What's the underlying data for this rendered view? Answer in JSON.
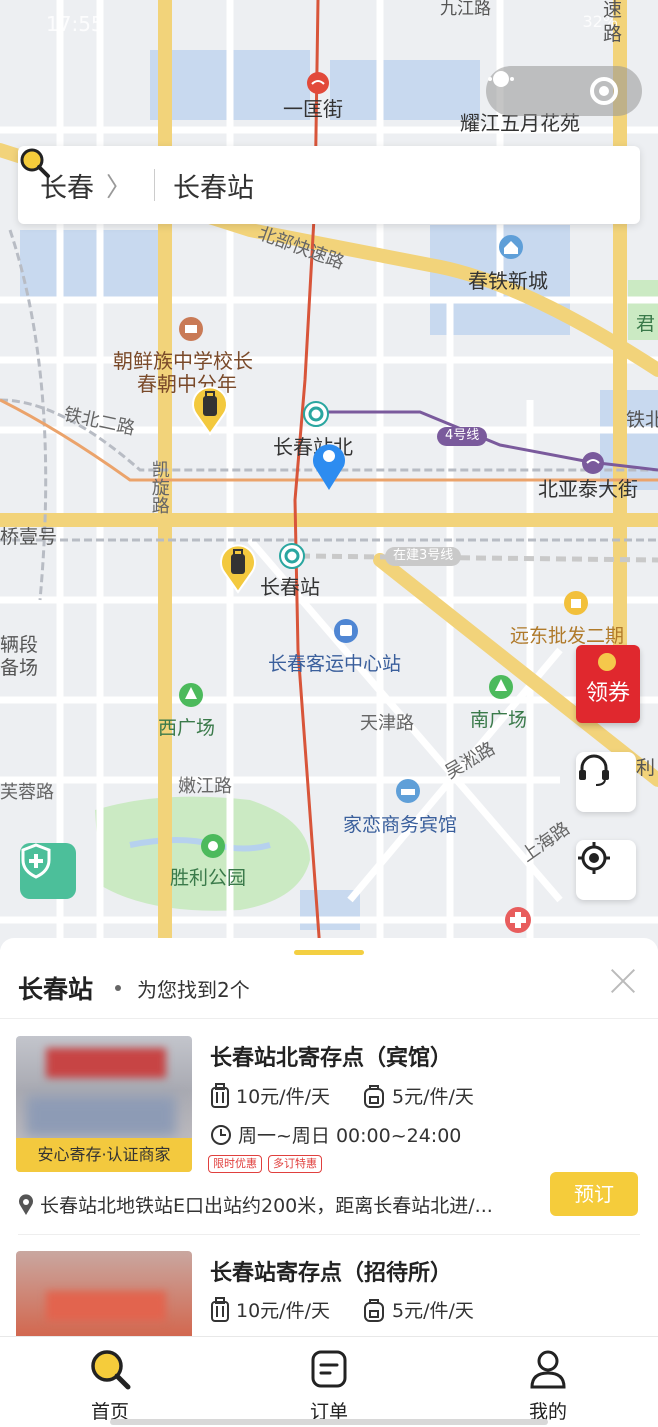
{
  "status_bar": {
    "time": "17:55",
    "battery": "32%"
  },
  "search": {
    "city": "长春",
    "query": "长春站"
  },
  "map": {
    "labels": {
      "nine_jiang": "九江路",
      "su": "速",
      "lu": "路",
      "yikuang": "一匡街",
      "yaojiang": "耀江五月花苑",
      "north_express": "北部快速路",
      "chuntie": "春铁新城",
      "chaoxian": "朝鲜族中学校长",
      "chunchao": "春朝中分年",
      "tiebei_er": "铁北二路",
      "changchun_north": "长春站北",
      "line4": "4号线",
      "tiebei": "铁北",
      "beiyatai": "北亚泰大街",
      "kaixuan": "凯旋路",
      "qiaoyi": "桥壹号",
      "line3": "在建3号线",
      "changchun_station": "长春站",
      "yuandong": "远东批发二期",
      "keyun": "长春客运中心站",
      "liangduan": "辆段",
      "beichang": "备场",
      "xiguangchang": "西广场",
      "tianjin": "天津路",
      "nanguangchang": "南广场",
      "wusong": "吴淞路",
      "furong": "芙蓉路",
      "nenjiang": "嫩江路",
      "jialian": "家恋商务宾馆",
      "shanghai": "上海路",
      "shengli": "胜利公园",
      "jun": "君",
      "li": "利"
    },
    "coupon_label": "领券"
  },
  "results": {
    "title": "长春站",
    "count_text": "为您找到2个",
    "items": [
      {
        "name": "长春站北寄存点（宾馆）",
        "price_big": "10元/件/天",
        "price_small": "5元/件/天",
        "hours": "周一~周日 00:00~24:00",
        "badge": "安心寄存·认证商家",
        "promos": [
          "限时优惠",
          "多订特惠"
        ],
        "address": "长春站北地铁站E口出站约200米，距离长春站北进/...",
        "book": "预订"
      },
      {
        "name": "长春站寄存点（招待所）",
        "price_big": "10元/件/天",
        "price_small": "5元/件/天"
      }
    ]
  },
  "tabbar": {
    "home": "首页",
    "orders": "订单",
    "mine": "我的"
  },
  "colors": {
    "accent": "#f5cc3b",
    "rail": "#d8553a",
    "metro4": "#7a5a9c",
    "main_road": "#f2d37a"
  },
  "icons": [
    "search-icon",
    "luggage-pin-icon",
    "location-pin-icon",
    "metro-icon",
    "bus-station-icon",
    "park-icon",
    "hotel-icon",
    "headset-icon",
    "locate-icon",
    "shield-icon",
    "suitcase-icon",
    "backpack-icon",
    "clock-icon",
    "home-search-icon",
    "orders-icon",
    "user-icon"
  ]
}
